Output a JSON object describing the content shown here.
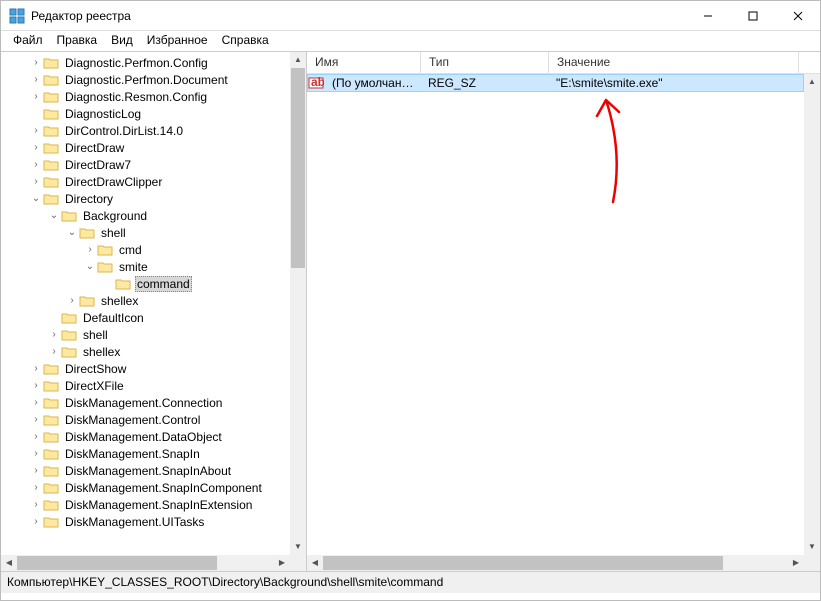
{
  "window": {
    "title": "Редактор реестра"
  },
  "menu": {
    "file": "Файл",
    "edit": "Правка",
    "view": "Вид",
    "favorites": "Избранное",
    "help": "Справка"
  },
  "tree": {
    "items": [
      {
        "indent": 1,
        "expander": "›",
        "label": "Diagnostic.Perfmon.Config"
      },
      {
        "indent": 1,
        "expander": "›",
        "label": "Diagnostic.Perfmon.Document"
      },
      {
        "indent": 1,
        "expander": "›",
        "label": "Diagnostic.Resmon.Config"
      },
      {
        "indent": 1,
        "expander": "",
        "label": "DiagnosticLog"
      },
      {
        "indent": 1,
        "expander": "›",
        "label": "DirControl.DirList.14.0"
      },
      {
        "indent": 1,
        "expander": "›",
        "label": "DirectDraw"
      },
      {
        "indent": 1,
        "expander": "›",
        "label": "DirectDraw7"
      },
      {
        "indent": 1,
        "expander": "›",
        "label": "DirectDrawClipper"
      },
      {
        "indent": 1,
        "expander": "⌄",
        "label": "Directory"
      },
      {
        "indent": 2,
        "expander": "⌄",
        "label": "Background"
      },
      {
        "indent": 3,
        "expander": "⌄",
        "label": "shell"
      },
      {
        "indent": 4,
        "expander": "›",
        "label": "cmd"
      },
      {
        "indent": 4,
        "expander": "⌄",
        "label": "smite"
      },
      {
        "indent": 5,
        "expander": "",
        "label": "command",
        "selected": true
      },
      {
        "indent": 3,
        "expander": "›",
        "label": "shellex"
      },
      {
        "indent": 2,
        "expander": "",
        "label": "DefaultIcon"
      },
      {
        "indent": 2,
        "expander": "›",
        "label": "shell"
      },
      {
        "indent": 2,
        "expander": "›",
        "label": "shellex"
      },
      {
        "indent": 1,
        "expander": "›",
        "label": "DirectShow"
      },
      {
        "indent": 1,
        "expander": "›",
        "label": "DirectXFile"
      },
      {
        "indent": 1,
        "expander": "›",
        "label": "DiskManagement.Connection"
      },
      {
        "indent": 1,
        "expander": "›",
        "label": "DiskManagement.Control"
      },
      {
        "indent": 1,
        "expander": "›",
        "label": "DiskManagement.DataObject"
      },
      {
        "indent": 1,
        "expander": "›",
        "label": "DiskManagement.SnapIn"
      },
      {
        "indent": 1,
        "expander": "›",
        "label": "DiskManagement.SnapInAbout"
      },
      {
        "indent": 1,
        "expander": "›",
        "label": "DiskManagement.SnapInComponent"
      },
      {
        "indent": 1,
        "expander": "›",
        "label": "DiskManagement.SnapInExtension"
      },
      {
        "indent": 1,
        "expander": "›",
        "label": "DiskManagement.UITasks"
      }
    ]
  },
  "list": {
    "columns": {
      "name": "Имя",
      "type": "Тип",
      "value": "Значение"
    },
    "rows": [
      {
        "name": "(По умолчанию)",
        "type": "REG_SZ",
        "value": "\"E:\\smite\\smite.exe\"",
        "selected": true
      }
    ]
  },
  "statusbar": {
    "path": "Компьютер\\HKEY_CLASSES_ROOT\\Directory\\Background\\shell\\smite\\command"
  },
  "col_widths": {
    "name": 114,
    "type": 128,
    "value": 250
  }
}
